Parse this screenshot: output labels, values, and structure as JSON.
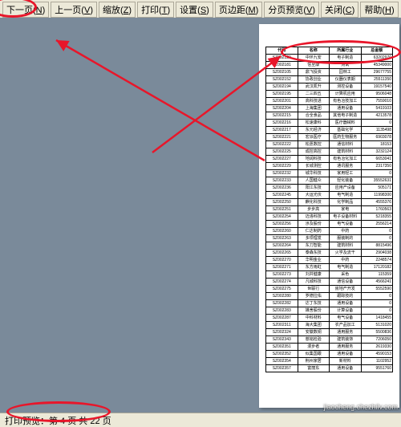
{
  "toolbar": {
    "buttons": [
      {
        "label": "下一页",
        "key": "N"
      },
      {
        "label": "上一页",
        "key": "V"
      },
      {
        "label": "缩放",
        "key": "Z"
      },
      {
        "label": "打印",
        "key": "T"
      },
      {
        "label": "设置",
        "key": "S"
      },
      {
        "label": "页边距",
        "key": "M"
      },
      {
        "label": "分页预览",
        "key": "V"
      },
      {
        "label": "关闭",
        "key": "C"
      },
      {
        "label": "帮助",
        "key": "H"
      }
    ]
  },
  "table": {
    "headers": [
      "代码",
      "名称",
      "所属行业",
      "总金额"
    ],
    "rows": [
      [
        "SZ002129",
        "中环九安",
        "电子制造",
        "63202970"
      ],
      [
        "SZ002181",
        "信至康",
        "测试",
        "45349000"
      ],
      [
        "SZ002105",
        "鼎飞投资",
        "园林工",
        "29677755"
      ],
      [
        "SZ002152",
        "协政创业",
        "仪器仪表期",
        "25511350"
      ],
      [
        "SZ002194",
        "武汉凯升",
        "测控设备",
        "19157540"
      ],
      [
        "SZ002195",
        "二三四五",
        "计算机应用",
        "9506048"
      ],
      [
        "SZ002201",
        "高科技进",
        "有色冶技加工",
        "7559010"
      ],
      [
        "SZ002204",
        "上海集团",
        "通用设备",
        "5419103"
      ],
      [
        "SZ002215",
        "合全食品",
        "其他电子制造",
        "4213578"
      ],
      [
        "SZ002216",
        "松速康科",
        "医疗器械料",
        "0"
      ],
      [
        "SZ002217",
        "东元经济",
        "基础化学",
        "1135498"
      ],
      [
        "SZ002221",
        "宏派医疗",
        "医药生物服务",
        "6903078"
      ],
      [
        "SZ002222",
        "松愿数控",
        "通信材料",
        "18153"
      ],
      [
        "SZ002225",
        "成控高控",
        "建筑材料",
        "3232124"
      ],
      [
        "SZ002227",
        "地阔科技",
        "有色冶化加工",
        "6653041"
      ],
      [
        "SZ002229",
        "长城测控",
        "通讯服务",
        "2317350"
      ],
      [
        "SZ002232",
        "城华科技",
        "家用轻工",
        "0"
      ],
      [
        "SZ002233",
        "人国健众",
        "轻化装备",
        "35552631"
      ],
      [
        "SZ002236",
        "阳江东技",
        "应用产设备",
        "505171"
      ],
      [
        "SZ002245",
        "大运光伏",
        "电气制造",
        "11998300"
      ],
      [
        "SZ002250",
        "麒化科技",
        "化学制品",
        "4555376"
      ],
      [
        "SZ002251",
        "步步高",
        "家电",
        "1760563"
      ],
      [
        "SZ002254",
        "迈洛科技",
        "电子设备材料",
        "5218355"
      ],
      [
        "SZ002256",
        "涉及股份",
        "电气设备",
        "2556214"
      ],
      [
        "SZ002260",
        "仁达制药",
        "中药",
        "0"
      ],
      [
        "SZ002263",
        "多项理发",
        "服装制的",
        "0"
      ],
      [
        "SZ002264",
        "东刀智能",
        "建筑材料",
        "8815496"
      ],
      [
        "SZ002265",
        "泰森东技",
        "火学及流干",
        "2904038"
      ],
      [
        "SZ002270",
        "华明金业",
        "中药",
        "2248574"
      ],
      [
        "SZ002271",
        "东方雨虹",
        "电气制造",
        "17120182"
      ],
      [
        "SZ002273",
        "刘井健康",
        "采色",
        "115359"
      ],
      [
        "SZ002274",
        "凡城科技",
        "通信设备",
        "4566241"
      ],
      [
        "SZ002275",
        "世联行",
        "房地产开发",
        "5552590"
      ],
      [
        "SZ002280",
        "罗德拉佑",
        "跟踪技的",
        "0"
      ],
      [
        "SZ002282",
        "达丁东技",
        "通用设备",
        "0"
      ],
      [
        "SZ002283",
        "媒舍股份",
        "计算设备",
        "0"
      ],
      [
        "SZ002287",
        "中科材料",
        "电气设备",
        "1418455"
      ],
      [
        "SZ002311",
        "海大集团",
        "农产品加工",
        "5131020"
      ],
      [
        "SZ002324",
        "安徽数铜",
        "通用服务",
        "5500836"
      ],
      [
        "SZ002343",
        "慈铭检验",
        "建筑装饰",
        "7206050"
      ],
      [
        "SZ002351",
        "漫步者",
        "通用服务",
        "2619330"
      ],
      [
        "SZ002352",
        "似集国跟",
        "通用设备",
        "4590153"
      ],
      [
        "SZ002354",
        "荆州家居",
        "新材料",
        "1102952"
      ],
      [
        "SZ002357",
        "富丽东",
        "通用设备",
        "9551760"
      ]
    ]
  },
  "status": {
    "text": "打印预览：第 4 页 共 22 页"
  },
  "watermark": "jiaocheng.chezhilv.com"
}
